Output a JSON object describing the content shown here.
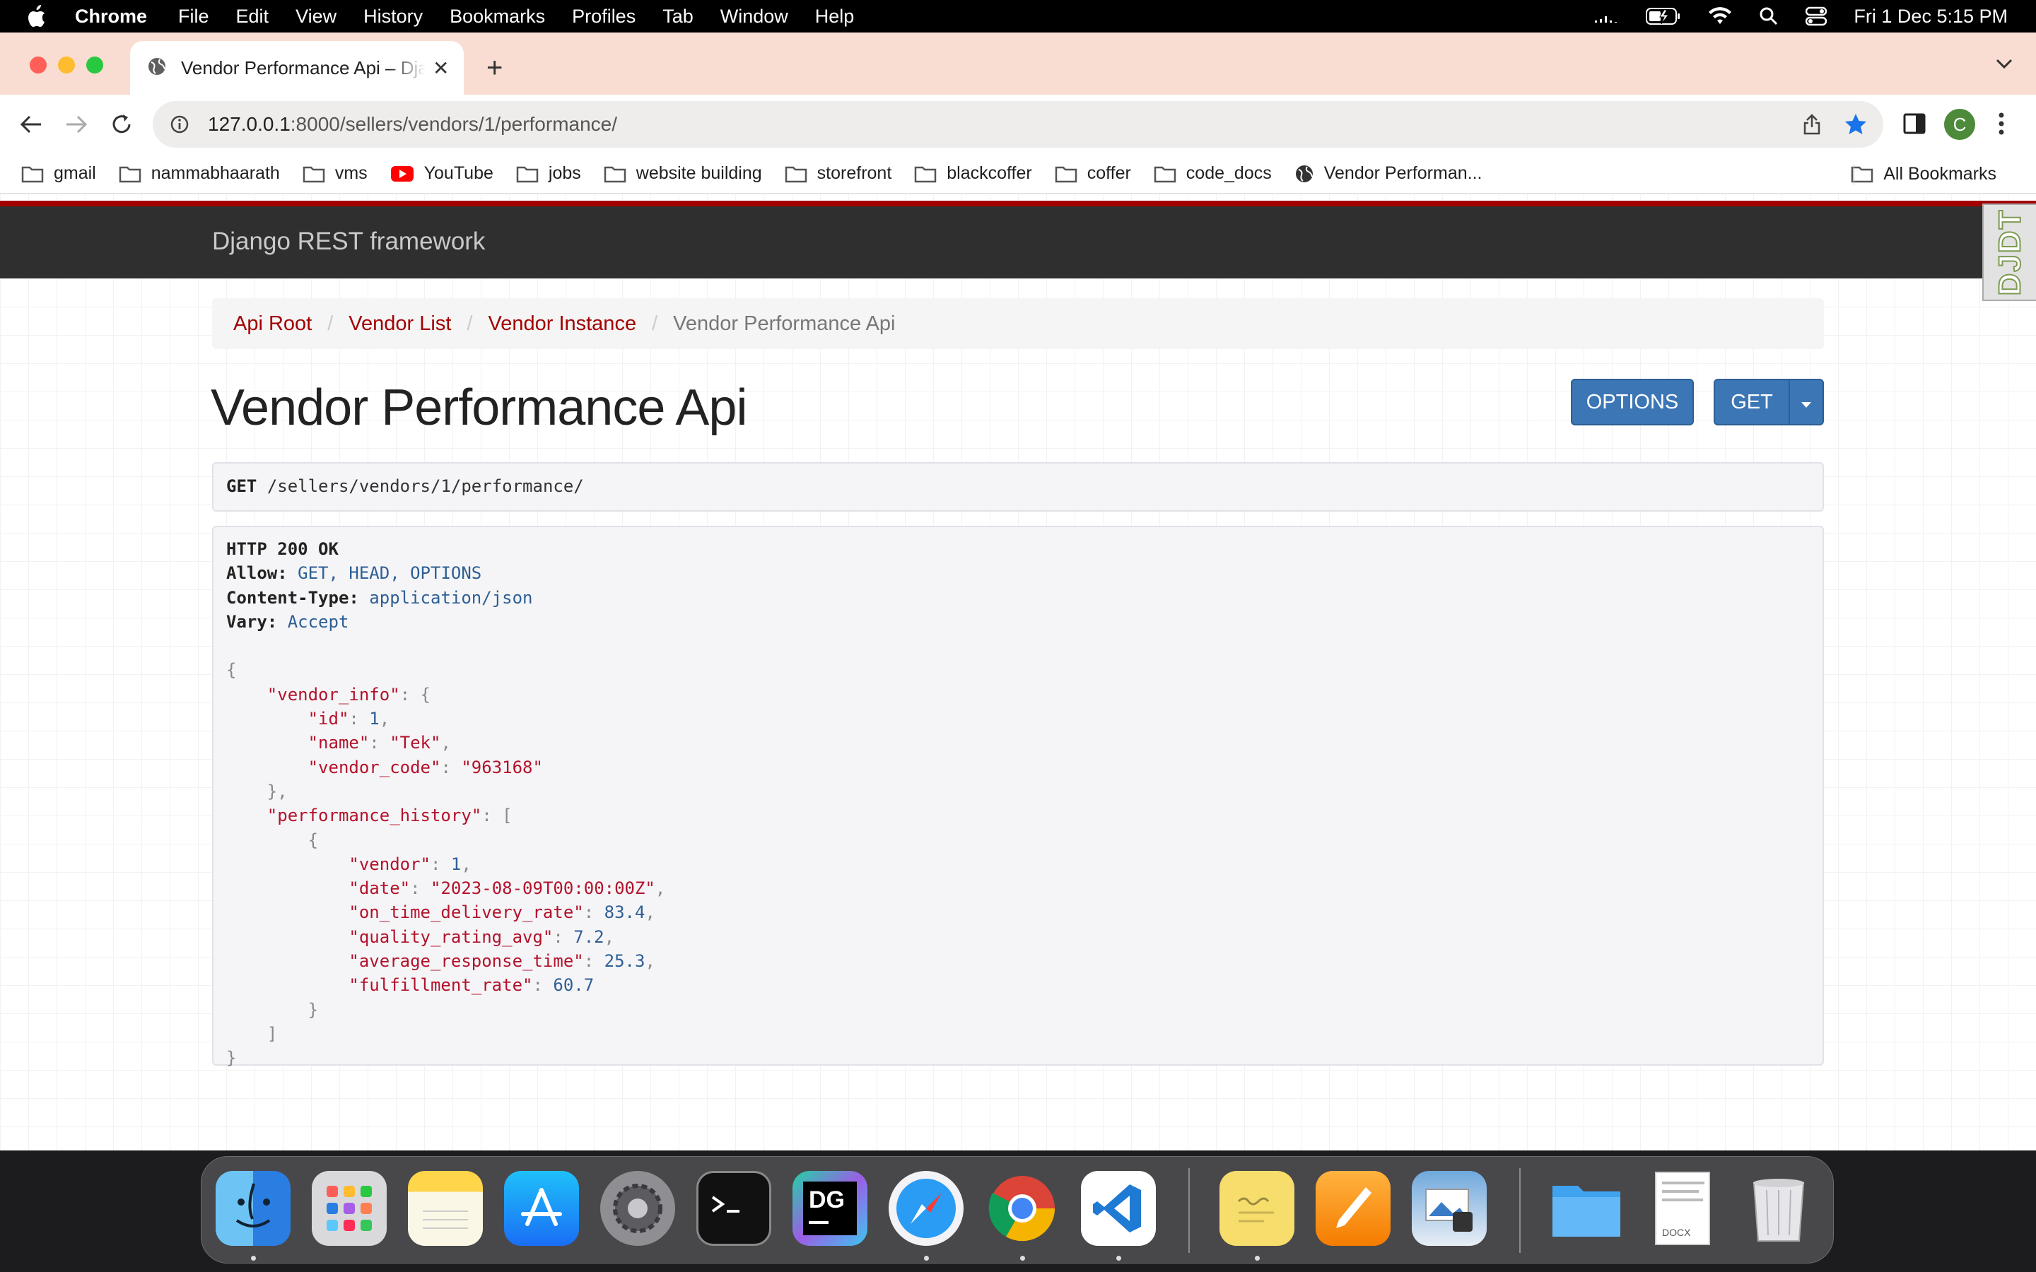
{
  "menubar": {
    "app_name": "Chrome",
    "menus": [
      "File",
      "Edit",
      "View",
      "History",
      "Bookmarks",
      "Profiles",
      "Tab",
      "Window",
      "Help"
    ],
    "clock": "Fri 1 Dec  5:15 PM"
  },
  "browser": {
    "tab_title": "Vendor Performance Api – Django REST framework",
    "url_host": "127.0.0.1",
    "url_path": ":8000/sellers/vendors/1/performance/",
    "avatar_letter": "C",
    "bookmarks": [
      "gmail",
      "nammabhaarath",
      "vms",
      "YouTube",
      "jobs",
      "website building",
      "storefront",
      "blackcoffer",
      "coffer",
      "code_docs",
      "Vendor Performan..."
    ],
    "all_bookmarks": "All Bookmarks"
  },
  "page": {
    "brand": "Django REST framework",
    "djdt": "DJDT",
    "breadcrumb": [
      "Api Root",
      "Vendor List",
      "Vendor Instance",
      "Vendor Performance Api"
    ],
    "title": "Vendor Performance Api",
    "options_label": "OPTIONS",
    "get_label": "GET",
    "request": {
      "method": "GET",
      "path": "/sellers/vendors/1/performance/"
    },
    "response": {
      "status": "HTTP 200 OK",
      "headers": [
        {
          "name": "Allow:",
          "value": "GET, HEAD, OPTIONS"
        },
        {
          "name": "Content-Type:",
          "value": "application/json"
        },
        {
          "name": "Vary:",
          "value": "Accept"
        }
      ],
      "body": {
        "vendor_info_key": "\"vendor_info\"",
        "vendor_info": [
          {
            "key": "\"id\"",
            "value": "1",
            "type": "num"
          },
          {
            "key": "\"name\"",
            "value": "\"Tek\"",
            "type": "str"
          },
          {
            "key": "\"vendor_code\"",
            "value": "\"963168\"",
            "type": "str"
          }
        ],
        "history_key": "\"performance_history\"",
        "history": [
          {
            "key": "\"vendor\"",
            "value": "1",
            "type": "num"
          },
          {
            "key": "\"date\"",
            "value": "\"2023-08-09T00:00:00Z\"",
            "type": "str"
          },
          {
            "key": "\"on_time_delivery_rate\"",
            "value": "83.4",
            "type": "num"
          },
          {
            "key": "\"quality_rating_avg\"",
            "value": "7.2",
            "type": "num"
          },
          {
            "key": "\"average_response_time\"",
            "value": "25.3",
            "type": "num"
          },
          {
            "key": "\"fulfillment_rate\"",
            "value": "60.7",
            "type": "num"
          }
        ]
      }
    }
  },
  "dock": {
    "apps": [
      "finder-icon",
      "launchpad-icon",
      "notes-icon",
      "app-store-icon",
      "system-settings-icon",
      "terminal-icon",
      "datagrip-icon",
      "safari-icon",
      "chrome-icon",
      "vscode-icon",
      "stickies-icon",
      "pages-icon",
      "preview-icon",
      "folder-icon",
      "docx-icon",
      "trash-icon"
    ],
    "datagrip_label": "DG",
    "docx_label": "DOCX"
  },
  "colors": {
    "drf_red": "#a30000",
    "drf_blue": "#3c76b5",
    "tab_strip": "#f9ddd2"
  }
}
